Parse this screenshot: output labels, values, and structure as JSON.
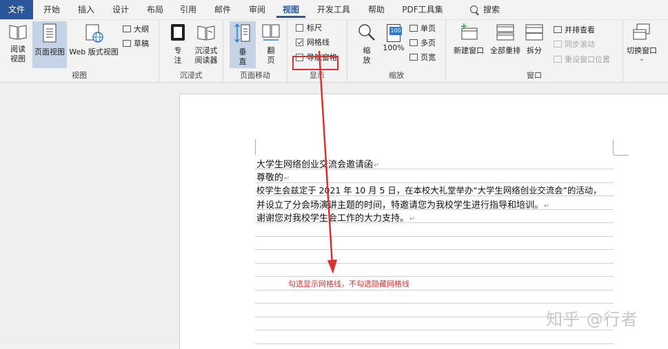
{
  "tabs": [
    {
      "label": "文件",
      "kind": "file"
    },
    {
      "label": "开始"
    },
    {
      "label": "插入"
    },
    {
      "label": "设计"
    },
    {
      "label": "布局"
    },
    {
      "label": "引用"
    },
    {
      "label": "邮件"
    },
    {
      "label": "审阅"
    },
    {
      "label": "视图",
      "kind": "active"
    },
    {
      "label": "开发工具"
    },
    {
      "label": "帮助"
    },
    {
      "label": "PDF工具集"
    }
  ],
  "search_label": "搜索",
  "ribbon": {
    "views": {
      "label": "视图",
      "read_mode": "阅读\n视图",
      "print_layout": "页面视图",
      "web_layout": "Web 版式视图",
      "outline": "大纲",
      "draft": "草稿"
    },
    "immersive": {
      "label": "沉浸式",
      "focus": "专\n注",
      "reader": "沉浸式\n阅读器"
    },
    "page_move": {
      "label": "页面移动",
      "vertical": "垂\n直",
      "side": "翻\n页"
    },
    "show": {
      "label": "显示",
      "ruler": "标尺",
      "gridlines": "网格线",
      "nav_pane": "导航窗格",
      "ruler_checked": false,
      "gridlines_checked": true,
      "nav_checked": false
    },
    "zoom": {
      "label": "缩放",
      "zoom": "缩\n放",
      "percent": "100%",
      "one_page": "单页",
      "multi_page": "多页",
      "page_width": "页宽",
      "badge": "100"
    },
    "window": {
      "label": "窗口",
      "new_window": "新建窗口",
      "arrange_all": "全部重排",
      "split": "拆分",
      "side_by_side": "并排查看",
      "sync_scroll": "同步滚动",
      "reset_pos": "重设窗口位置",
      "switch": "切换窗口"
    }
  },
  "document": {
    "lines": [
      "大学生网络创业交流会邀请函",
      "尊敬的",
      "校学生会兹定于 2021 年 10 月 5 日，在本校大礼堂举办“大学生网络创业交流会”的活动，",
      "并设立了分会场演讲主题的时间，特邀请您为我校学生进行指导和培训。",
      "谢谢您对我校学生会工作的大力支持。"
    ],
    "para_mark": "↵"
  },
  "annotation": "勾选显示网格线，不勾选隐藏网格线",
  "watermark": "知乎 @行者",
  "colors": {
    "accent": "#2b579a",
    "annotation": "#d8332f",
    "pressed": "#c5d3e6"
  }
}
